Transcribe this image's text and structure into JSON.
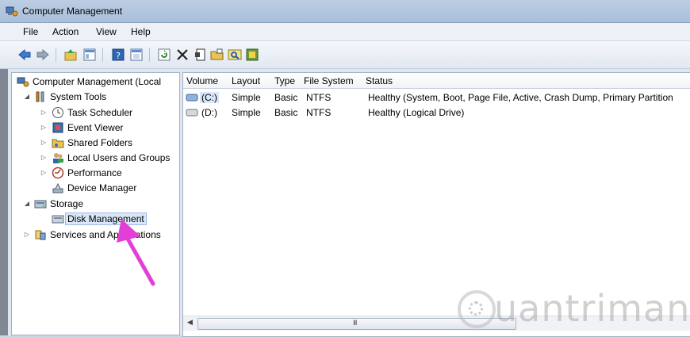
{
  "window": {
    "title": "Computer Management"
  },
  "menu": [
    "File",
    "Action",
    "View",
    "Help"
  ],
  "toolbar": {
    "icons": [
      "back-arrow-icon",
      "forward-arrow-icon",
      "up-folder-icon",
      "show-hide-tree-icon",
      "help-icon",
      "console-icon",
      "refresh-icon",
      "delete-icon",
      "properties-icon",
      "open-folder-icon",
      "magnifier-icon",
      "options-icon"
    ]
  },
  "tree": {
    "root": "Computer Management (Local",
    "system_tools": "System Tools",
    "task_scheduler": "Task Scheduler",
    "event_viewer": "Event Viewer",
    "shared_folders": "Shared Folders",
    "local_users": "Local Users and Groups",
    "performance": "Performance",
    "device_manager": "Device Manager",
    "storage": "Storage",
    "disk_management": "Disk Management",
    "services_pre": "Services and Ap",
    "services_post": "cations"
  },
  "table": {
    "columns": [
      "Volume",
      "Layout",
      "Type",
      "File System",
      "Status"
    ],
    "rows": [
      {
        "volume": "(C:)",
        "layout": "Simple",
        "type": "Basic",
        "fs": "NTFS",
        "status": "Healthy (System, Boot, Page File, Active, Crash Dump, Primary Partition"
      },
      {
        "volume": "(D:)",
        "layout": "Simple",
        "type": "Basic",
        "fs": "NTFS",
        "status": "Healthy (Logical Drive)"
      }
    ]
  },
  "scrollbar": {
    "grip": "III"
  },
  "annotation": {
    "arrow_color": "#e23fd6"
  },
  "watermark": "uantrimang",
  "colors": {
    "selection": "#d9e7f8",
    "accent": "#2d67b4"
  }
}
